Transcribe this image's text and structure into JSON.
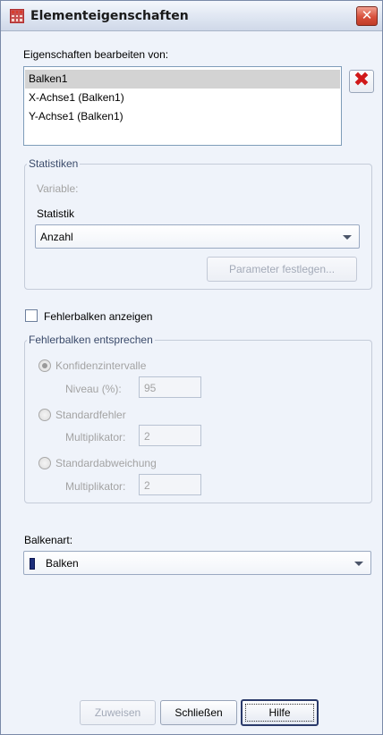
{
  "window": {
    "title": "Elementeigenschaften",
    "close_glyph": "✕"
  },
  "edit_section": {
    "label": "Eigenschaften bearbeiten von:",
    "items": [
      "Balken1",
      "X-Achse1 (Balken1)",
      "Y-Achse1 (Balken1)"
    ],
    "selected_index": 0,
    "delete_glyph": "✖"
  },
  "statistics": {
    "legend": "Statistiken",
    "variable_label": "Variable:",
    "statistic_label": "Statistik",
    "statistic_value": "Anzahl",
    "set_parameters_label": "Parameter festlegen..."
  },
  "error_bars": {
    "show_label": "Fehlerbalken anzeigen",
    "show_checked": false,
    "group_legend": "Fehlerbalken entsprechen",
    "options": [
      {
        "label": "Konfidenzintervalle",
        "field_label": "Niveau (%):",
        "field_value": "95",
        "checked": true
      },
      {
        "label": "Standardfehler",
        "field_label": "Multiplikator:",
        "field_value": "2",
        "checked": false
      },
      {
        "label": "Standardabweichung",
        "field_label": "Multiplikator:",
        "field_value": "2",
        "checked": false
      }
    ]
  },
  "bar_type": {
    "label": "Balkenart:",
    "value": "Balken"
  },
  "footer": {
    "apply_label": "Zuweisen",
    "close_label": "Schließen",
    "help_label": "Hilfe"
  },
  "colors": {
    "window_bg": "#eff3fa",
    "selected_row": "#d3d3d3",
    "delete_red": "#d01818",
    "disabled_text": "#a3a3a3"
  }
}
